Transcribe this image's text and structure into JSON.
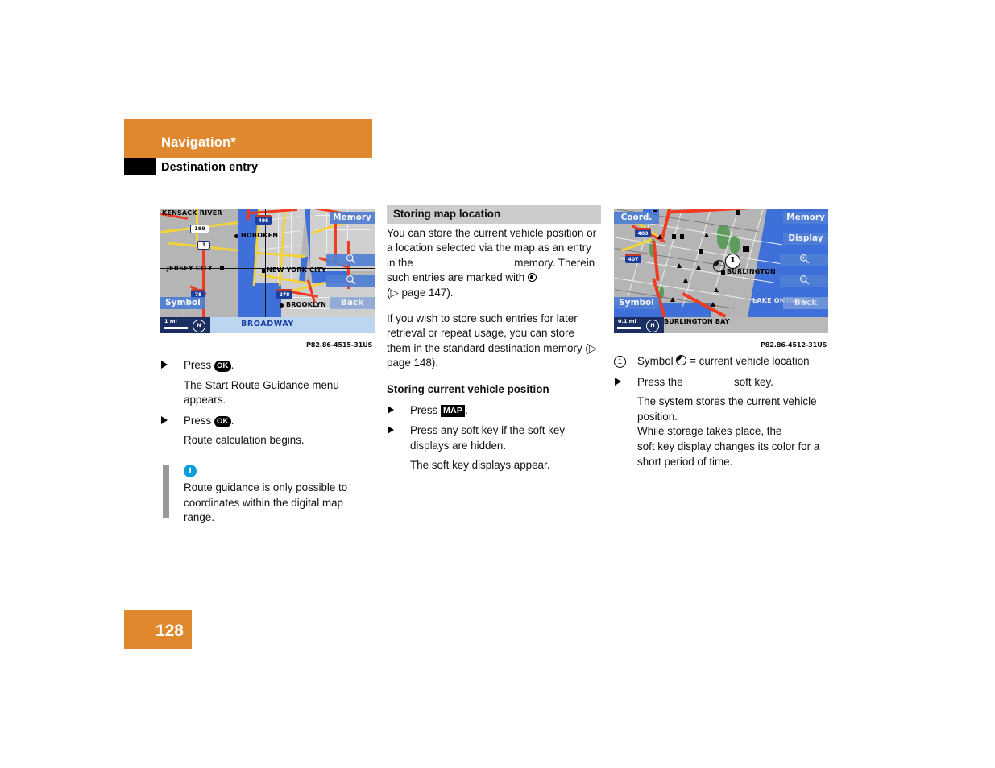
{
  "header": {
    "chapter": "Navigation*",
    "section": "Destination entry"
  },
  "footer": {
    "page_number": "128"
  },
  "colors": {
    "accent_orange": "#e0882e",
    "section_band_gray": "#cccccc",
    "info_blue": "#0d9ddb",
    "note_bar_gray": "#999999",
    "map_water_blue": "#3f6fd8",
    "map_softkey_blue": "#4f7fd4"
  },
  "left_column": {
    "image_caption": "P82.86-4515-31US",
    "steps": [
      {
        "icon": "arrow-bullet",
        "text_before": "Press ",
        "key": "OK",
        "text_after": "."
      },
      {
        "type": "result",
        "text": "The Start Route Guidance menu appears."
      },
      {
        "icon": "arrow-bullet",
        "text_before": "Press ",
        "key": "OK",
        "text_after": "."
      },
      {
        "type": "result",
        "text": "Route calculation begins."
      }
    ],
    "note": {
      "icon": "info-icon",
      "text": "Route guidance is only possible to coordinates within the digital map range."
    }
  },
  "middle_column": {
    "section_title": "Storing map location",
    "paragraph_1_a": "You can store the current vehicle position or a location selected via the map as an entry in the ",
    "paragraph_1_b": " memory. Therein such entries are marked with ",
    "paragraph_1_c": "(▷ page 147).",
    "paragraph_2": "If you wish to store such entries for later retrieval or repeat usage, you can store them in the standard destination memory (▷ page 148).",
    "subsection_title": "Storing current vehicle position",
    "steps": [
      {
        "icon": "arrow-bullet",
        "text_before": "Press ",
        "key": "MAP",
        "text_after": "."
      },
      {
        "icon": "arrow-bullet",
        "text": "Press any soft key if the soft key displays are hidden."
      },
      {
        "type": "result",
        "text": "The soft key displays appear."
      }
    ]
  },
  "right_column": {
    "image_caption": "P82.86-4512-31US",
    "legend": {
      "number": "1",
      "label_before": "Symbol ",
      "symbol": "vehicle-location-symbol",
      "label_after": " = current vehicle location"
    },
    "steps": [
      {
        "icon": "arrow-bullet",
        "text_before": "Press the ",
        "softkey": "",
        "text_after": " soft key."
      },
      {
        "type": "result",
        "text": "The system stores the current vehicle position."
      },
      {
        "type": "result",
        "text": "While storage takes place, the"
      },
      {
        "type": "result",
        "text": "soft key display changes its color for a short period of time."
      }
    ]
  },
  "map_left": {
    "alt": "Navigation map screen - New York City area",
    "labels": [
      {
        "name": "KENSACK RIVER"
      },
      {
        "name": "HOBOKEN"
      },
      {
        "name": "JERSEY CITY"
      },
      {
        "name": "NEW YORK CITY"
      },
      {
        "name": "BROOKLYN"
      }
    ],
    "route_shields": [
      "189",
      "1",
      "78",
      "278",
      "495"
    ],
    "soft_keys": {
      "top_right": "Memory",
      "bottom_left": "Symbol",
      "bottom_right": "Back",
      "zoom_in": "zoom-in-icon",
      "zoom_out": "zoom-out-icon"
    },
    "status_bar": {
      "scale": "1 mi",
      "compass": "N",
      "street": "BROADWAY"
    }
  },
  "map_right": {
    "alt": "Navigation map screen - Burlington, Lake Ontario area",
    "labels": [
      {
        "name": "BURLINGTON"
      },
      {
        "name": "LAKE ONTARIO"
      },
      {
        "name": "BURLINGTON BAY"
      }
    ],
    "route_shields": [
      "403",
      "407"
    ],
    "callout_number": "1",
    "soft_keys": {
      "top_left": "Coord.",
      "top_right": "Memory",
      "second_right": "Display",
      "bottom_left": "Symbol",
      "bottom_right": "Back",
      "zoom_in": "zoom-in-icon",
      "zoom_out": "zoom-out-icon"
    },
    "status_bar": {
      "scale": "0.1 mi",
      "compass": "N"
    }
  }
}
